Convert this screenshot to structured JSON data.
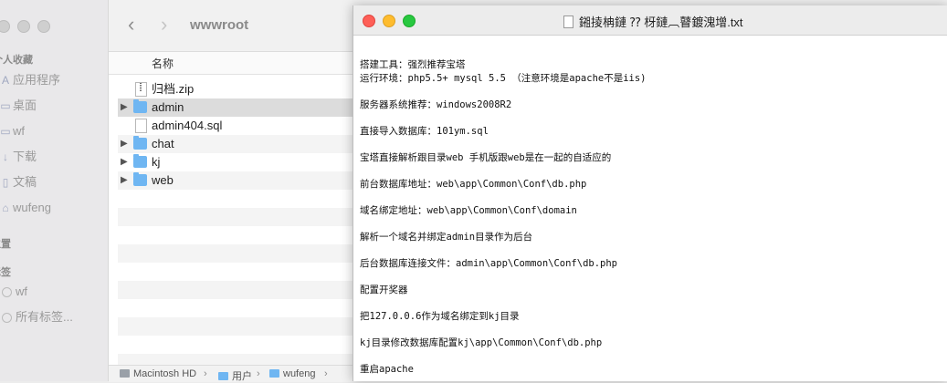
{
  "finder": {
    "folder_title": "wwwroot",
    "sidebar": {
      "favorites_header": "个人收藏",
      "favorites": [
        {
          "label": "应用程序",
          "icon": "applications-icon"
        },
        {
          "label": "桌面",
          "icon": "desktop-icon"
        },
        {
          "label": "wf",
          "icon": "folder-icon"
        },
        {
          "label": "下载",
          "icon": "downloads-icon"
        },
        {
          "label": "文稿",
          "icon": "documents-icon"
        },
        {
          "label": "wufeng",
          "icon": "home-icon"
        }
      ],
      "locations_header": "位置",
      "tags_header": "标签",
      "tags": [
        {
          "label": "wf"
        },
        {
          "label": "所有标签..."
        }
      ]
    },
    "column_header": "名称",
    "files": [
      {
        "name": "归档.zip",
        "type": "zip",
        "expandable": false
      },
      {
        "name": "admin",
        "type": "folder",
        "expandable": true
      },
      {
        "name": "admin404.sql",
        "type": "document",
        "expandable": false
      },
      {
        "name": "chat",
        "type": "folder",
        "expandable": true
      },
      {
        "name": "kj",
        "type": "folder",
        "expandable": true
      },
      {
        "name": "web",
        "type": "folder",
        "expandable": true
      }
    ],
    "path_bar": [
      "Macintosh HD",
      "用户",
      "wufeng"
    ]
  },
  "editor": {
    "title": "鎺掕柟鏈 ⁇ 枒鏈︹瞽鍍溾增.txt",
    "lines": [
      "搭建工具：强烈推荐宝塔",
      "运行环境：php5.5+ mysql 5.5 （注意环境是apache不是iis)",
      "",
      "服务器系统推荐：windows2008R2",
      "",
      "直接导入数据库：101ym.sql",
      "",
      "宝塔直接解析跟目录web 手机版跟web是在一起的自适应的",
      "",
      "前台数据库地址：web\\app\\Common\\Conf\\db.php",
      "",
      "域名绑定地址：web\\app\\Common\\Conf\\domain",
      "",
      "解析一个域名并绑定admin目录作为后台",
      "",
      "后台数据库连接文件：admin\\app\\Common\\Conf\\db.php",
      "",
      "配置开奖器",
      "",
      "把127.0.0.6作为域名绑定到kj目录",
      "",
      "kj目录修改数据库配置kj\\app\\Common\\Conf\\db.php",
      "",
      "重启apache"
    ]
  }
}
